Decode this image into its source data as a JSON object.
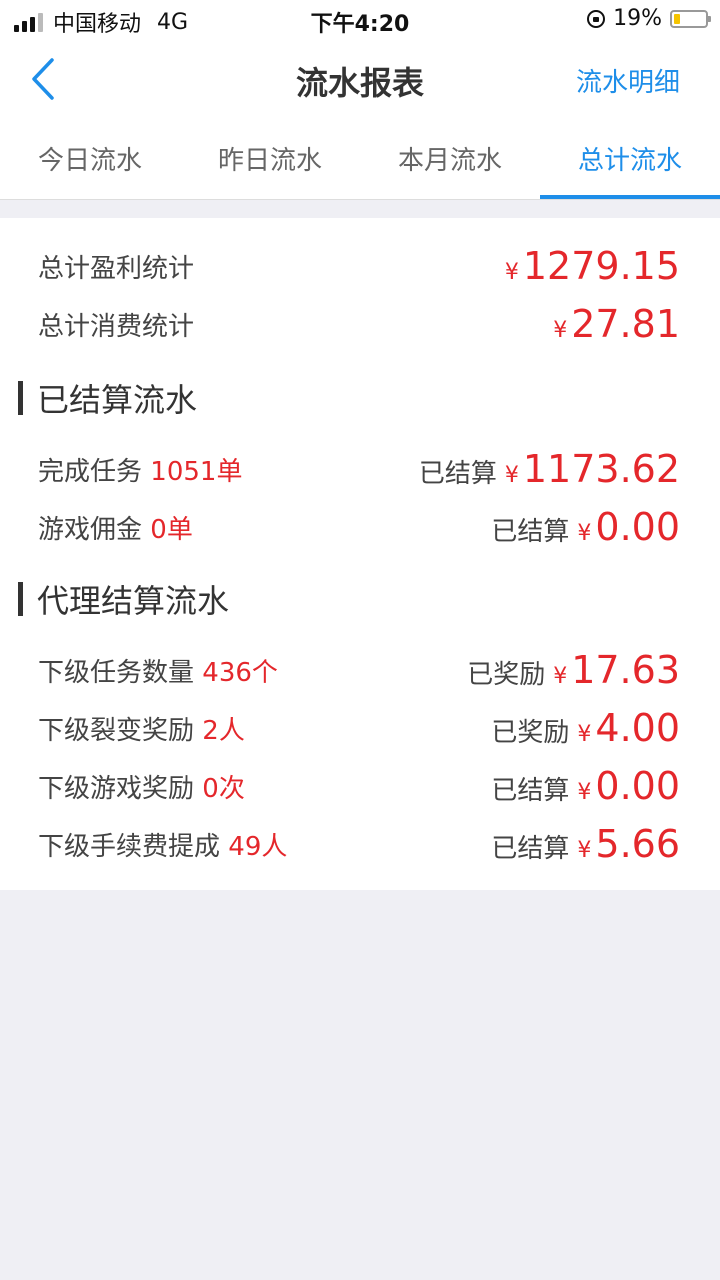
{
  "status_bar": {
    "carrier": "中国移动",
    "network": "4G",
    "time": "下午4:20",
    "battery_text": "19%",
    "battery_level": 0.19
  },
  "nav": {
    "title": "流水报表",
    "right_link": "流水明细"
  },
  "tabs": [
    {
      "label": "今日流水",
      "active": false
    },
    {
      "label": "昨日流水",
      "active": false
    },
    {
      "label": "本月流水",
      "active": false
    },
    {
      "label": "总计流水",
      "active": true
    }
  ],
  "summary": {
    "profit_label": "总计盈利统计",
    "profit_value": "1279.15",
    "consume_label": "总计消费统计",
    "consume_value": "27.81"
  },
  "currency_symbol": "¥",
  "settled_section": {
    "title": "已结算流水",
    "rows": [
      {
        "label": "完成任务",
        "count": "1051单",
        "status": "已结算",
        "amount": "1173.62"
      },
      {
        "label": "游戏佣金",
        "count": "0单",
        "status": "已结算",
        "amount": "0.00"
      }
    ]
  },
  "agent_section": {
    "title": "代理结算流水",
    "rows": [
      {
        "label": "下级任务数量",
        "count": "436个",
        "status": "已奖励",
        "amount": "17.63"
      },
      {
        "label": "下级裂变奖励",
        "count": "2人",
        "status": "已奖励",
        "amount": "4.00"
      },
      {
        "label": "下级游戏奖励",
        "count": "0次",
        "status": "已结算",
        "amount": "0.00"
      },
      {
        "label": "下级手续费提成",
        "count": "49人",
        "status": "已结算",
        "amount": "5.66"
      }
    ]
  },
  "colors": {
    "accent": "#1e8ee9",
    "amount_red": "#e4272b",
    "background": "#efeff4"
  }
}
